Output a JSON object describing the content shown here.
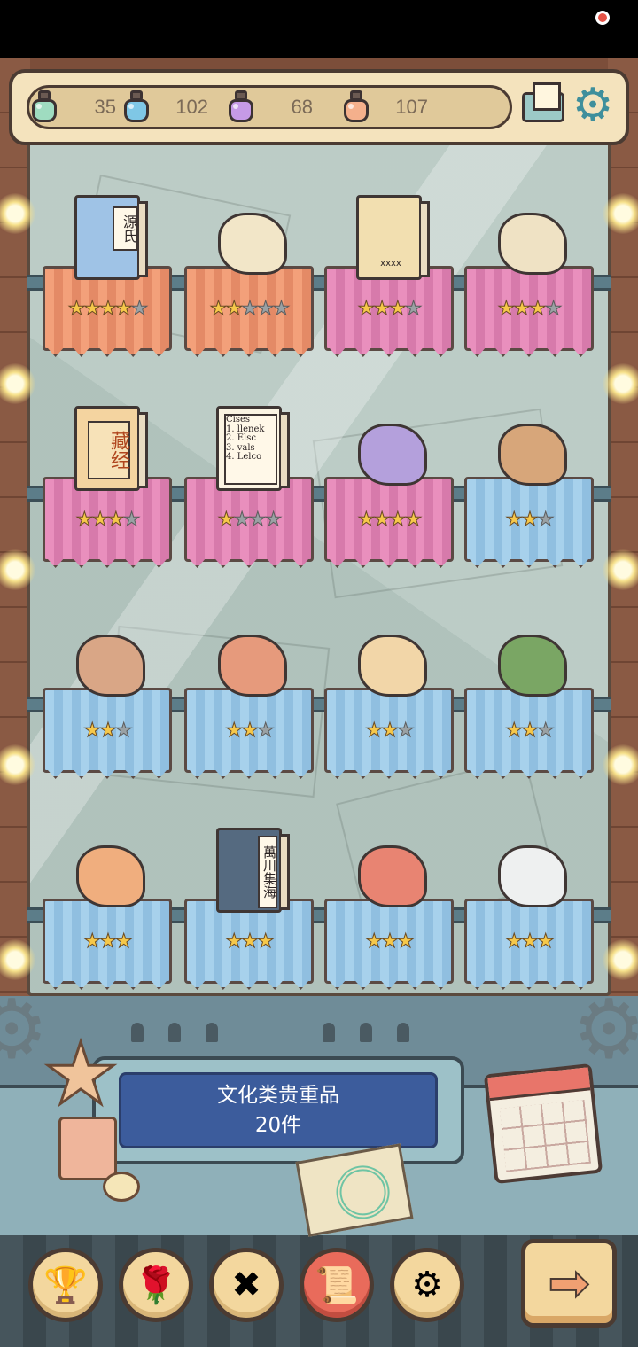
{
  "resources": [
    {
      "value": "35",
      "color": "#9fdcc0",
      "icon": "green-potion-icon"
    },
    {
      "value": "102",
      "color": "#7fc7e6",
      "icon": "blue-potion-icon"
    },
    {
      "value": "68",
      "color": "#c69ae6",
      "icon": "purple-potion-icon"
    },
    {
      "value": "107",
      "color": "#f4b08c",
      "icon": "orange-potion-icon"
    }
  ],
  "collection": {
    "category": "文化类贵重品",
    "count": "20件"
  },
  "shelves": [
    [
      {
        "name": "genji-book",
        "rating": 4,
        "max": 5,
        "cloth": "orange",
        "label": "源氏"
      },
      {
        "name": "anatomy-book",
        "rating": 2,
        "max": 5,
        "cloth": "orange"
      },
      {
        "name": "shakespeare-portrait",
        "rating": 3,
        "max": 4,
        "cloth": "pink",
        "label": "xxxx"
      },
      {
        "name": "dinosaur-skull",
        "rating": 3,
        "max": 4,
        "cloth": "pink"
      }
    ],
    [
      {
        "name": "sutra-book",
        "rating": 3,
        "max": 4,
        "cloth": "pink",
        "label": "藏经"
      },
      {
        "name": "note-list",
        "rating": 1,
        "max": 4,
        "cloth": "pink",
        "label": "Cises\n1. llenek\n2. Elsc\n3. vals\n4. Lelco"
      },
      {
        "name": "purple-tome",
        "rating": 4,
        "max": 4,
        "cloth": "pink"
      },
      {
        "name": "smoking-pipe",
        "rating": 2,
        "max": 3,
        "cloth": "blue"
      }
    ],
    [
      {
        "name": "seated-statue",
        "rating": 2,
        "max": 3,
        "cloth": "blue"
      },
      {
        "name": "ice-axe",
        "rating": 2,
        "max": 3,
        "cloth": "blue"
      },
      {
        "name": "scroll-and-quill",
        "rating": 2,
        "max": 3,
        "cloth": "blue"
      },
      {
        "name": "potted-plant",
        "rating": 2,
        "max": 3,
        "cloth": "blue"
      }
    ],
    [
      {
        "name": "tribal-spear",
        "rating": 3,
        "max": 3,
        "cloth": "blue"
      },
      {
        "name": "eye-book",
        "rating": 3,
        "max": 3,
        "cloth": "blue",
        "label": "萬川集海"
      },
      {
        "name": "fish-skeleton",
        "rating": 3,
        "max": 3,
        "cloth": "blue"
      },
      {
        "name": "tribal-mask",
        "rating": 3,
        "max": 3,
        "cloth": "blue"
      }
    ]
  ],
  "nav": [
    {
      "name": "trophy-cup-icon",
      "glyph": "🏆",
      "active": false
    },
    {
      "name": "rose-icon",
      "glyph": "🌹",
      "active": false
    },
    {
      "name": "crossed-bones-icon",
      "glyph": "✖",
      "active": false
    },
    {
      "name": "scroll-icon",
      "glyph": "📜",
      "active": true
    },
    {
      "name": "gear-icon",
      "glyph": "⚙",
      "active": false
    }
  ],
  "next_glyph": "➡"
}
